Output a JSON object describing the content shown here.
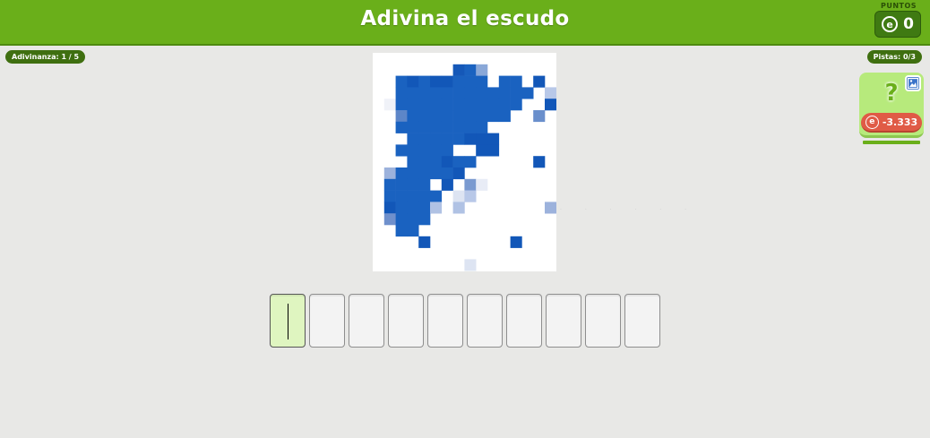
{
  "header": {
    "title": "Adivina el escudo",
    "score_label": "PUNTOS",
    "score_value": "0",
    "coin_glyph": "e"
  },
  "riddle_counter": "Adivinanza: 1 / 5",
  "hints_counter": "Pistas: 0/3",
  "hint_card": {
    "glyph": "?",
    "cost": "-3.333",
    "icon": "image-icon"
  },
  "answer": {
    "length": 10,
    "active_index": 0,
    "letters": [
      "",
      "",
      "",
      "",
      "",
      "",
      "",
      "",
      "",
      ""
    ]
  },
  "image": {
    "description_icon": "pixelated-shield",
    "pixels": [
      [
        7,
        1,
        "#1558b8"
      ],
      [
        8,
        1,
        "#1a62c0"
      ],
      [
        9,
        1,
        "#8aa8d8"
      ],
      [
        2,
        2,
        "#1a62c0"
      ],
      [
        3,
        2,
        "#1257b8"
      ],
      [
        4,
        2,
        "#1a62c0"
      ],
      [
        5,
        2,
        "#1257b8"
      ],
      [
        6,
        2,
        "#1257b8"
      ],
      [
        7,
        2,
        "#1a62c0"
      ],
      [
        8,
        2,
        "#1a62c0"
      ],
      [
        9,
        2,
        "#1a62c0"
      ],
      [
        11,
        2,
        "#1a62c0"
      ],
      [
        12,
        2,
        "#1a62c0"
      ],
      [
        14,
        2,
        "#1257b8"
      ],
      [
        2,
        3,
        "#1a62c0"
      ],
      [
        3,
        3,
        "#1a62c0"
      ],
      [
        4,
        3,
        "#1a62c0"
      ],
      [
        5,
        3,
        "#1a62c0"
      ],
      [
        6,
        3,
        "#1a62c0"
      ],
      [
        7,
        3,
        "#1a62c0"
      ],
      [
        8,
        3,
        "#1a62c0"
      ],
      [
        9,
        3,
        "#1a62c0"
      ],
      [
        10,
        3,
        "#1a62c0"
      ],
      [
        11,
        3,
        "#1a62c0"
      ],
      [
        12,
        3,
        "#1a62c0"
      ],
      [
        13,
        3,
        "#1a62c0"
      ],
      [
        15,
        3,
        "#b8c8e8"
      ],
      [
        1,
        4,
        "#f0f2f8"
      ],
      [
        2,
        4,
        "#1a62c0"
      ],
      [
        3,
        4,
        "#1a62c0"
      ],
      [
        4,
        4,
        "#1a62c0"
      ],
      [
        5,
        4,
        "#1a62c0"
      ],
      [
        6,
        4,
        "#1a62c0"
      ],
      [
        7,
        4,
        "#1a62c0"
      ],
      [
        8,
        4,
        "#1a62c0"
      ],
      [
        9,
        4,
        "#1a62c0"
      ],
      [
        10,
        4,
        "#1a62c0"
      ],
      [
        11,
        4,
        "#1a62c0"
      ],
      [
        12,
        4,
        "#1a62c0"
      ],
      [
        15,
        4,
        "#1257b8"
      ],
      [
        2,
        5,
        "#5d86c8"
      ],
      [
        3,
        5,
        "#1a62c0"
      ],
      [
        4,
        5,
        "#1a62c0"
      ],
      [
        5,
        5,
        "#1a62c0"
      ],
      [
        6,
        5,
        "#1a62c0"
      ],
      [
        7,
        5,
        "#1a62c0"
      ],
      [
        8,
        5,
        "#1a62c0"
      ],
      [
        9,
        5,
        "#1a62c0"
      ],
      [
        10,
        5,
        "#1a62c0"
      ],
      [
        11,
        5,
        "#1a62c0"
      ],
      [
        14,
        5,
        "#6a8fcc"
      ],
      [
        2,
        6,
        "#1a62c0"
      ],
      [
        3,
        6,
        "#1a62c0"
      ],
      [
        4,
        6,
        "#1a62c0"
      ],
      [
        5,
        6,
        "#1a62c0"
      ],
      [
        6,
        6,
        "#1a62c0"
      ],
      [
        7,
        6,
        "#1a62c0"
      ],
      [
        8,
        6,
        "#1a62c0"
      ],
      [
        9,
        6,
        "#1a62c0"
      ],
      [
        3,
        7,
        "#1a62c0"
      ],
      [
        4,
        7,
        "#1a62c0"
      ],
      [
        5,
        7,
        "#1a62c0"
      ],
      [
        6,
        7,
        "#1a62c0"
      ],
      [
        7,
        7,
        "#1a62c0"
      ],
      [
        8,
        7,
        "#1257b8"
      ],
      [
        9,
        7,
        "#1257b8"
      ],
      [
        10,
        7,
        "#1257b8"
      ],
      [
        2,
        8,
        "#1a62c0"
      ],
      [
        3,
        8,
        "#1a62c0"
      ],
      [
        4,
        8,
        "#1a62c0"
      ],
      [
        5,
        8,
        "#1a62c0"
      ],
      [
        6,
        8,
        "#1a62c0"
      ],
      [
        9,
        8,
        "#1257b8"
      ],
      [
        10,
        8,
        "#1257b8"
      ],
      [
        3,
        9,
        "#1a62c0"
      ],
      [
        4,
        9,
        "#1a62c0"
      ],
      [
        5,
        9,
        "#1a62c0"
      ],
      [
        6,
        9,
        "#1257b8"
      ],
      [
        7,
        9,
        "#1a62c0"
      ],
      [
        8,
        9,
        "#1a62c0"
      ],
      [
        14,
        9,
        "#1257b8"
      ],
      [
        1,
        10,
        "#9cb2dc"
      ],
      [
        2,
        10,
        "#1a62c0"
      ],
      [
        3,
        10,
        "#1a62c0"
      ],
      [
        4,
        10,
        "#1a62c0"
      ],
      [
        5,
        10,
        "#1a62c0"
      ],
      [
        6,
        10,
        "#1a62c0"
      ],
      [
        7,
        10,
        "#1257b8"
      ],
      [
        1,
        11,
        "#1a62c0"
      ],
      [
        2,
        11,
        "#1a62c0"
      ],
      [
        3,
        11,
        "#1a62c0"
      ],
      [
        4,
        11,
        "#1a62c0"
      ],
      [
        6,
        11,
        "#1257b8"
      ],
      [
        8,
        11,
        "#7a9ad0"
      ],
      [
        9,
        11,
        "#e8ecf6"
      ],
      [
        1,
        12,
        "#1a62c0"
      ],
      [
        2,
        12,
        "#1a62c0"
      ],
      [
        3,
        12,
        "#1a62c0"
      ],
      [
        4,
        12,
        "#1a62c0"
      ],
      [
        5,
        12,
        "#1a62c0"
      ],
      [
        7,
        12,
        "#dde4f2"
      ],
      [
        8,
        12,
        "#b8c8e8"
      ],
      [
        1,
        13,
        "#1257b8"
      ],
      [
        2,
        13,
        "#1a62c0"
      ],
      [
        3,
        13,
        "#1a62c0"
      ],
      [
        4,
        13,
        "#1a62c0"
      ],
      [
        5,
        13,
        "#b0c2e4"
      ],
      [
        7,
        13,
        "#b0c2e4"
      ],
      [
        15,
        13,
        "#9cb2dc"
      ],
      [
        1,
        14,
        "#6f90cc"
      ],
      [
        2,
        14,
        "#1a62c0"
      ],
      [
        3,
        14,
        "#1a62c0"
      ],
      [
        4,
        14,
        "#1a62c0"
      ],
      [
        2,
        15,
        "#1a62c0"
      ],
      [
        3,
        15,
        "#1a62c0"
      ],
      [
        4,
        16,
        "#1257b8"
      ],
      [
        12,
        16,
        "#1257b8"
      ],
      [
        8,
        18,
        "#dde4f2"
      ]
    ]
  }
}
